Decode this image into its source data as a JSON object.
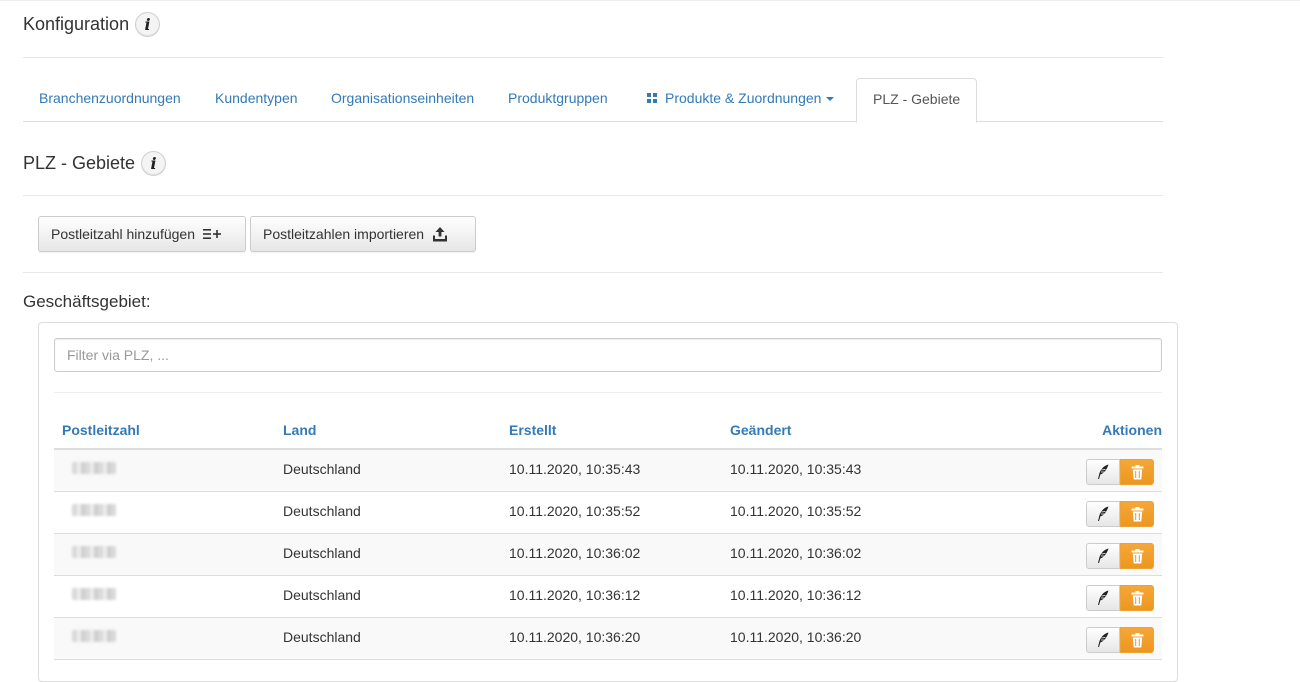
{
  "header": {
    "title": "Konfiguration",
    "info_icon": "i"
  },
  "tabs": [
    {
      "label": "Branchenzuordnungen"
    },
    {
      "label": "Kundentypen"
    },
    {
      "label": "Organisationseinheiten"
    },
    {
      "label": "Produktgruppen"
    },
    {
      "label": "Produkte & Zuordnungen",
      "icon": "grid-icon",
      "dropdown": true
    },
    {
      "label": "PLZ - Gebiete",
      "active": true
    }
  ],
  "section": {
    "title": "PLZ - Gebiete",
    "info_icon": "i"
  },
  "toolbar": {
    "add_label": "Postleitzahl hinzufügen",
    "add_icon": "list-add-icon",
    "import_label": "Postleitzahlen importieren",
    "import_icon": "upload-icon"
  },
  "area": {
    "label": "Geschäftsgebiet:"
  },
  "filter": {
    "placeholder": "Filter via PLZ, ...",
    "value": ""
  },
  "table": {
    "columns": [
      "Postleitzahl",
      "Land",
      "Erstellt",
      "Geändert",
      "Aktionen"
    ],
    "rows": [
      {
        "plz": "",
        "land": "Deutschland",
        "erstellt": "10.11.2020, 10:35:43",
        "geaendert": "10.11.2020, 10:35:43"
      },
      {
        "plz": "",
        "land": "Deutschland",
        "erstellt": "10.11.2020, 10:35:52",
        "geaendert": "10.11.2020, 10:35:52"
      },
      {
        "plz": "",
        "land": "Deutschland",
        "erstellt": "10.11.2020, 10:36:02",
        "geaendert": "10.11.2020, 10:36:02"
      },
      {
        "plz": "",
        "land": "Deutschland",
        "erstellt": "10.11.2020, 10:36:12",
        "geaendert": "10.11.2020, 10:36:12"
      },
      {
        "plz": "",
        "land": "Deutschland",
        "erstellt": "10.11.2020, 10:36:20",
        "geaendert": "10.11.2020, 10:36:20"
      }
    ],
    "actions": {
      "edit_icon": "feather-edit-icon",
      "delete_icon": "trash-icon"
    }
  },
  "colors": {
    "link": "#337ab7",
    "warning": "#f0ad4e",
    "border": "#dddddd"
  }
}
